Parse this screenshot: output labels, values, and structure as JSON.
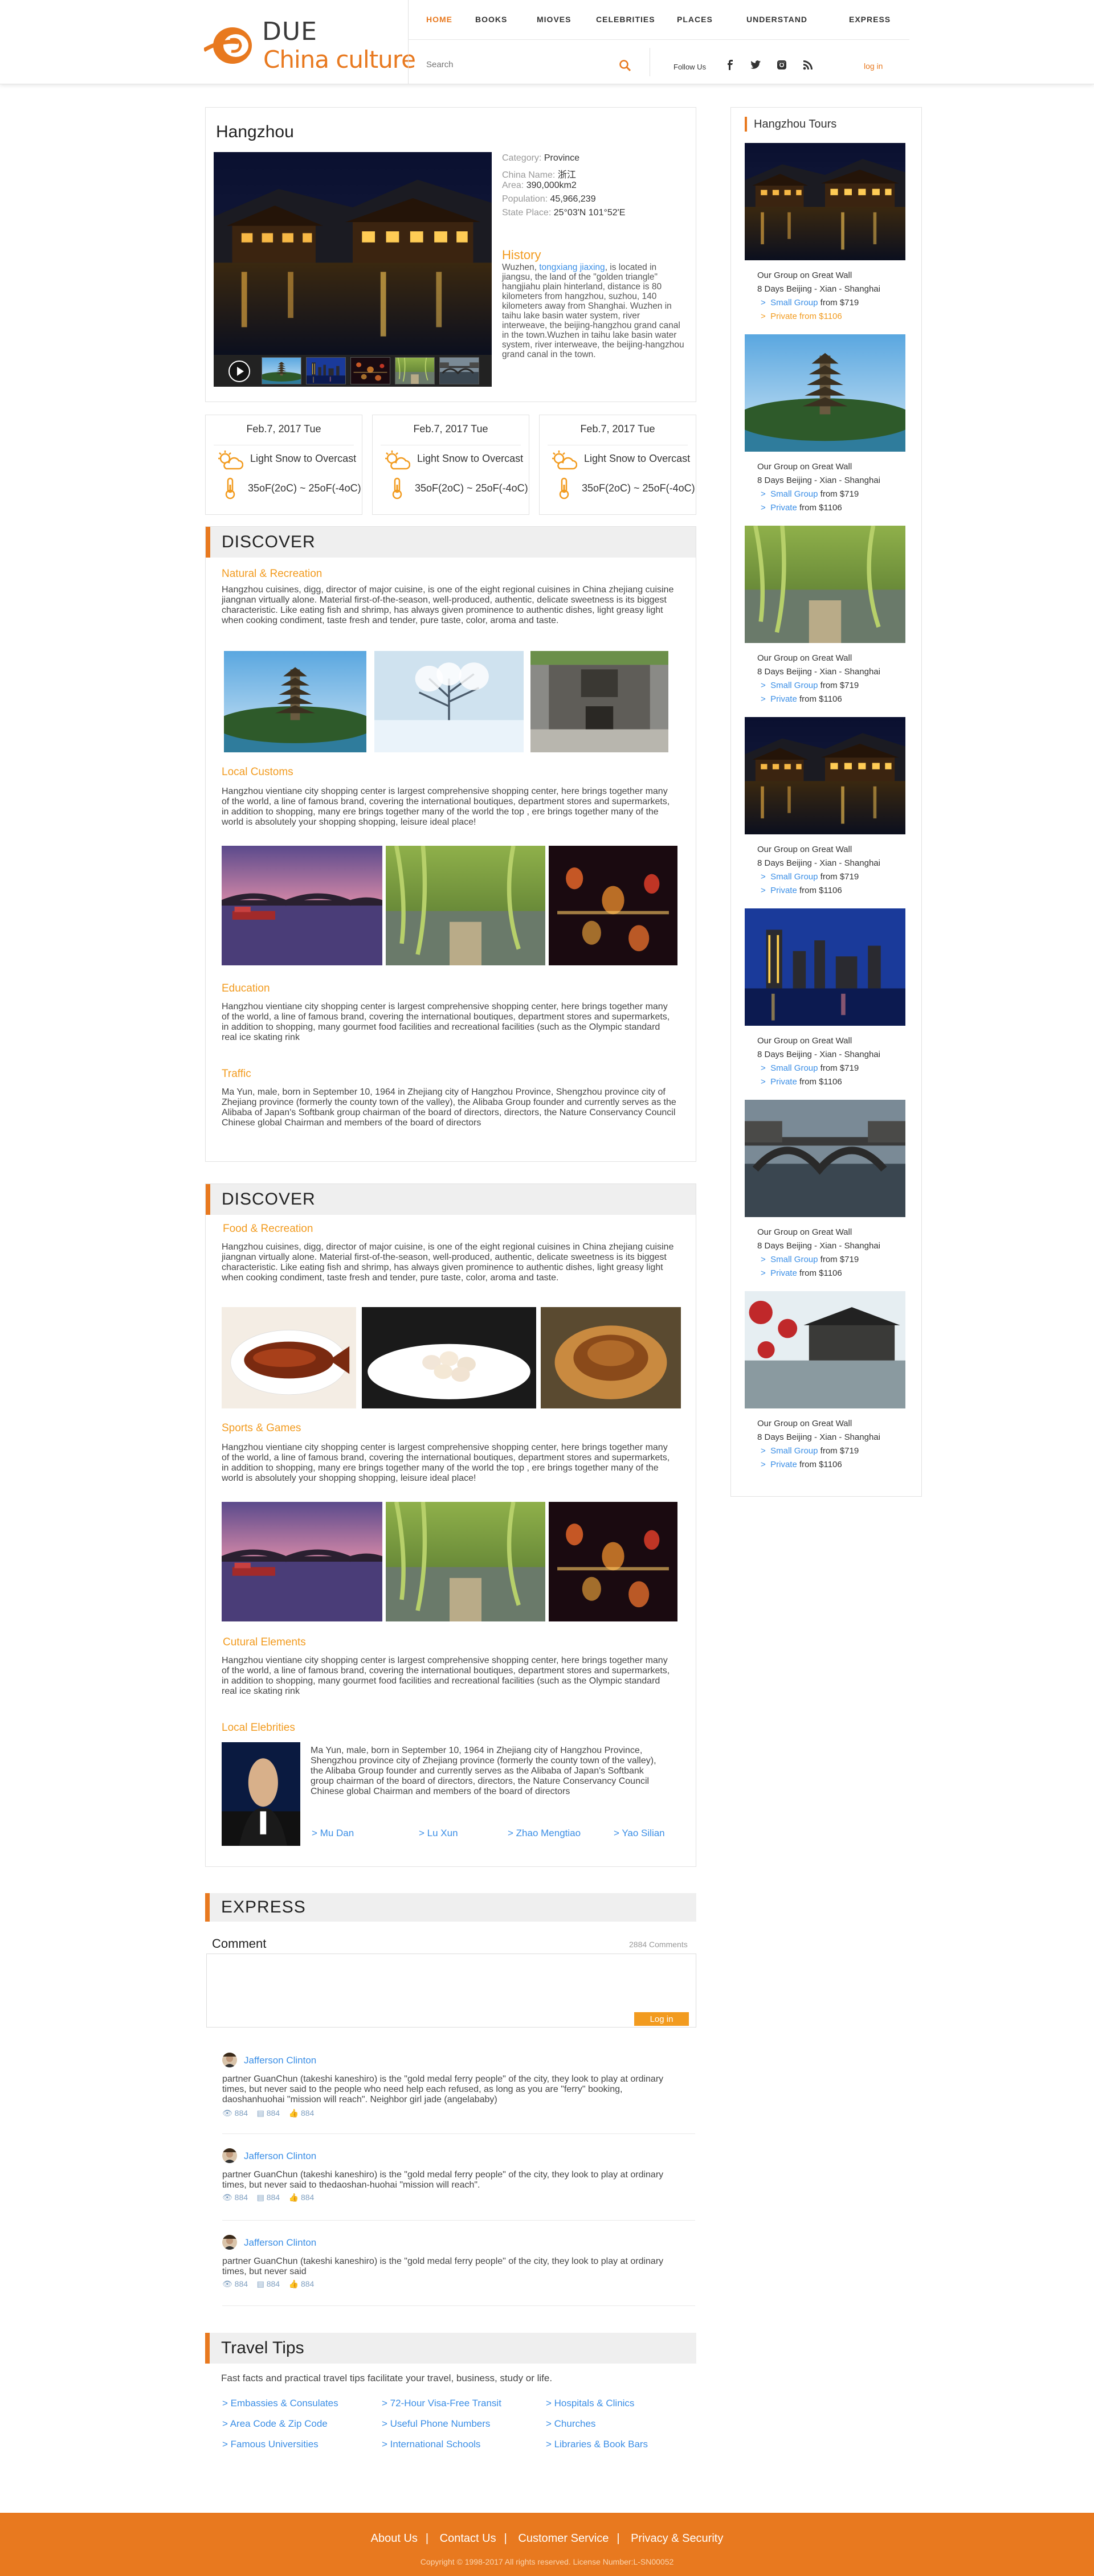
{
  "header": {
    "logo_top": "DUE",
    "logo_bottom": "China culture",
    "nav": [
      "HOME",
      "BOOKS",
      "MIOVES",
      "CELEBRITIES",
      "PLACES",
      "UNDERSTAND",
      "EXPRESS"
    ],
    "search_placeholder": "Search",
    "follow_label": "Follow Us",
    "login": "log in"
  },
  "city": {
    "name": "Hangzhou",
    "facts": [
      {
        "key": "Category:",
        "value": "Province"
      },
      {
        "key": "China Name:",
        "value": "浙江"
      },
      {
        "key": "Area:",
        "value": "390,000km2"
      },
      {
        "key": "Population:",
        "value": "45,966,239"
      },
      {
        "key": "State Place:",
        "value": "25°03'N 101°52'E"
      }
    ],
    "history_title": "History",
    "history_pre": "Wuzhen, ",
    "history_link": "tongxiang jiaxing",
    "history_post": ", is located in jiangsu, the land of the \"golden triangle\" hangjiahu plain hinterland, distance is 80 kilometers from hangzhou, suzhou, 140 kilometers away from Shanghai. Wuzhen in taihu lake basin water system, river interweave, the beijing-hangzhou grand canal in the town.Wuzhen in taihu lake basin water system, river interweave, the beijing-hangzhou grand canal in the town."
  },
  "weather": [
    {
      "date": "Feb.7, 2017 Tue",
      "condition": "Light Snow to Overcast",
      "temp": "35oF(2oC) ~ 25oF(-4oC)"
    },
    {
      "date": "Feb.7, 2017 Tue",
      "condition": "Light Snow to Overcast",
      "temp": "35oF(2oC) ~ 25oF(-4oC)"
    },
    {
      "date": "Feb.7, 2017 Tue",
      "condition": "Light Snow to Overcast",
      "temp": "35oF(2oC) ~ 25oF(-4oC)"
    }
  ],
  "discover1": {
    "title": "DISCOVER",
    "natural_title": "Natural & Recreation",
    "natural_text": "Hangzhou cuisines, digg, director of major cuisine, is one of the eight regional cuisines in China zhejiang cuisine jiangnan virtually alone. Material first-of-the-season, well-produced, authentic, delicate sweetness is its biggest characteristic. Like eating fish and shrimp, has always given prominence to authentic dishes,  light greasy light when cooking condiment, taste fresh and tender, pure taste, color, aroma and taste.",
    "customs_title": "Local Customs",
    "customs_text": "Hangzhou vientiane city shopping center is largest comprehensive shopping center, here brings together many of the world, a line of famous brand, covering the international boutiques, department stores and supermarkets, in addition to shopping, many  ere brings together many of the world the top , ere brings together many of the world is absolutely your shopping shopping, leisure ideal place!",
    "education_title": "Education",
    "education_text": "Hangzhou vientiane city shopping center is largest comprehensive shopping center,  here brings together many of the world, a line of famous brand, covering the international boutiques, department stores and supermarkets, in addition to shopping, many gourmet food facilities and recreational facilities (such as the Olympic standard real ice skating rink",
    "traffic_title": "Traffic",
    "traffic_text": "Ma Yun, male, born in September 10, 1964 in Zhejiang city of Hangzhou Province, Shengzhou province city of Zhejiang province (formerly the county town of the valley), the Alibaba Group founder and currently serves as the Alibaba of Japan's Softbank group chairman of the board of directors, directors, the Nature Conservancy Council Chinese global Chairman and members of the board of directors"
  },
  "discover2": {
    "title": "DISCOVER",
    "food_title": "Food & Recreation",
    "food_text": "Hangzhou cuisines, digg, director of major cuisine, is one of the eight regional cuisines in China zhejiang cuisine jiangnan virtually alone. Material first-of-the-season, well-produced, authentic, delicate sweetness is its biggest characteristic. Like eating fish and shrimp, has always given prominence to authentic dishes,  light greasy light when cooking condiment, taste fresh and tender, pure taste, color, aroma and taste.",
    "sports_title": "Sports &  Games",
    "sports_text": "Hangzhou vientiane city shopping center is largest comprehensive shopping center, here brings together many of the world, a line of famous brand, covering the international boutiques, department stores and supermarkets, in addition to shopping, many  ere brings together many of the world the top , ere brings together many of the world is absolutely your shopping shopping, leisure ideal place!",
    "cultural_title": "Cutural Elements",
    "cultural_text": "Hangzhou vientiane city shopping center is largest comprehensive shopping center,  here brings together many of the world, a line of famous brand, covering the international boutiques, department stores and supermarkets, in addition to shopping, many gourmet food facilities and recreational facilities (such as the Olympic standard real ice skating rink",
    "celebrities_title": "Local Elebrities",
    "celebrities_text": "Ma Yun, male, born in September 10, 1964 in Zhejiang city of Hangzhou Province, Shengzhou province city of Zhejiang province (formerly the county town of the valley), the Alibaba Group founder and currently serves as the Alibaba of Japan's Softbank group chairman of the board of directors, directors, the Nature Conservancy Council Chinese global Chairman and members of the board of directors",
    "names": [
      "Mu Dan",
      "Lu Xun",
      "Zhao Mengtiao",
      "Yao Silian"
    ]
  },
  "express": {
    "title": "EXPRESS",
    "comment_label": "Comment",
    "comment_count": "2884 Comments",
    "submit": "Log in",
    "comments": [
      {
        "author": "Jafferson Clinton",
        "text": "partner GuanChun (takeshi kaneshiro) is the \"gold medal ferry people\" of the city, they look to play at ordinary times, but never said to the people who need help each refused, as long as you are \"ferry\" booking, daoshanhuohai \"mission will reach\". Neighbor girl jade (angelababy)",
        "views": "884",
        "comments": "884",
        "likes": "884"
      },
      {
        "author": "Jafferson Clinton",
        "text": "partner GuanChun (takeshi kaneshiro) is the \"gold medal ferry people\" of the city, they look to play at ordinary times, but never said to thedaoshan-huohai \"mission will reach\".",
        "views": "884",
        "comments": "884",
        "likes": "884"
      },
      {
        "author": "Jafferson Clinton",
        "text": "partner GuanChun (takeshi kaneshiro) is the \"gold medal ferry people\" of the city, they look to play at ordinary times, but never said",
        "views": "884",
        "comments": "884",
        "likes": "884"
      }
    ]
  },
  "tips": {
    "title": "Travel Tips",
    "intro": "Fast facts and practical travel tips facilitate your travel, business, study or life.",
    "links": [
      [
        "Embassies & Consulates",
        "72-Hour Visa-Free Transit",
        "Hospitals & Clinics"
      ],
      [
        "Area Code & Zip Code",
        "Useful Phone Numbers",
        "Churches"
      ],
      [
        "Famous Universities",
        "International Schools",
        "Libraries & Book Bars"
      ]
    ]
  },
  "footer": {
    "links": [
      "About Us",
      "Contact Us",
      "Customer Service",
      "Privacy & Security"
    ],
    "copyright": "Copyright © 1998-2017 All rights reserved. License Number:L-SN00052"
  },
  "tours": {
    "title": "Hangzhou Tours",
    "items": [
      {
        "name": "Our Group on Great Wall",
        "route": "8 Days Beijing - Xian - Shanghai",
        "opt1": "Small Group",
        "p1": "from $719",
        "opt2": "Private from $1106",
        "p2": "",
        "scene": "night-water",
        "opt2_orange": true
      },
      {
        "name": "Our Group on Great Wall",
        "route": "8 Days Beijing - Xian - Shanghai",
        "opt1": "Small Group",
        "p1": "from $719",
        "opt2": "Private",
        "p2": "from $1106",
        "scene": "pagoda"
      },
      {
        "name": "Our Group on Great Wall",
        "route": "8 Days Beijing - Xian - Shanghai",
        "opt1": "Small Group",
        "p1": "from $719",
        "opt2": "Private",
        "p2": "from $1106",
        "scene": "willow"
      },
      {
        "name": "Our Group on Great Wall",
        "route": "8 Days Beijing - Xian - Shanghai",
        "opt1": "Small Group",
        "p1": "from $719",
        "opt2": "Private",
        "p2": "from $1106",
        "scene": "night-water"
      },
      {
        "name": "Our Group on Great Wall",
        "route": "8 Days Beijing - Xian - Shanghai",
        "opt1": "Small Group",
        "p1": "from $719",
        "opt2": "Private",
        "p2": "from $1106",
        "scene": "skyline"
      },
      {
        "name": "Our Group on Great Wall",
        "route": "8 Days Beijing - Xian - Shanghai",
        "opt1": "Small Group",
        "p1": "from $719",
        "opt2": "Private",
        "p2": "from $1106",
        "scene": "bridge"
      },
      {
        "name": "Our Group on Great Wall",
        "route": "8 Days Beijing - Xian - Shanghai",
        "opt1": "Small Group",
        "p1": "from $719",
        "opt2": "Private",
        "p2": "from $1106",
        "scene": "lanterns"
      }
    ]
  },
  "colors": {
    "accent": "#e8791f",
    "link": "#3a8ee6",
    "subtitle": "#f29b1f"
  }
}
